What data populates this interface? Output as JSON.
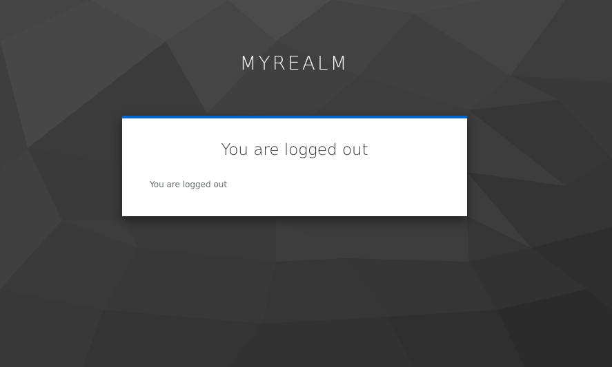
{
  "realm": {
    "name": "MYREALM"
  },
  "card": {
    "title": "You are logged out",
    "message": "You are logged out",
    "accent_color": "#0066cc"
  },
  "background": {
    "style": "dark low-poly triangle pattern",
    "base_color": "#3a3a3a"
  }
}
